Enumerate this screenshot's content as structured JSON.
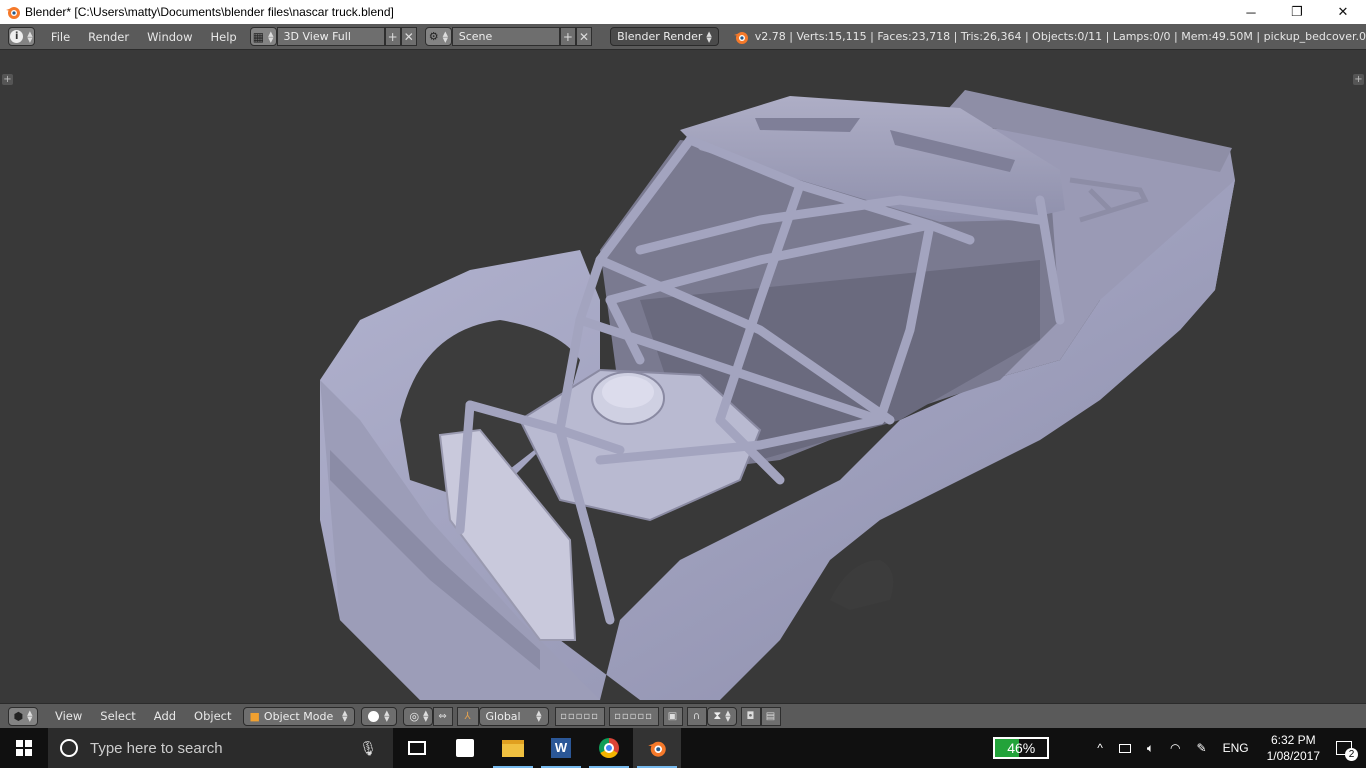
{
  "window": {
    "title": "Blender* [C:\\Users\\matty\\Documents\\blender files\\nascar truck.blend]",
    "minimize": "─",
    "maximize": "❐",
    "close": "✕"
  },
  "info_header": {
    "menus": [
      "File",
      "Render",
      "Window",
      "Help"
    ],
    "screen_layout": "3D View Full",
    "scene": "Scene",
    "render_engine": "Blender Render",
    "stats": "v2.78 | Verts:15,115 | Faces:23,718 | Tris:26,364 | Objects:0/11 | Lamps:0/0 | Mem:49.50M | pickup_bedcover.0"
  },
  "view3d_header": {
    "menus": [
      "View",
      "Select",
      "Add",
      "Object"
    ],
    "mode": "Object Mode",
    "orientation": "Global"
  },
  "taskbar": {
    "search_placeholder": "Type here to search",
    "battery": "46%",
    "language": "ENG",
    "time": "6:32 PM",
    "date": "1/08/2017",
    "notifications": "2"
  },
  "colors": {
    "accent_blue": "#76b9ed",
    "model": "#9fa0bf",
    "battery_green": "#23a33a"
  }
}
